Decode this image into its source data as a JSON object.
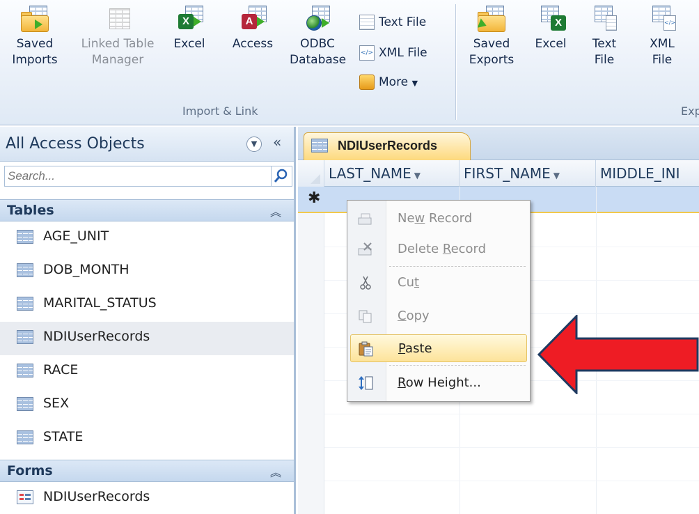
{
  "ribbon": {
    "import_group": {
      "label": "Import & Link",
      "saved_imports": "Saved Imports",
      "linked_table_manager": "Linked Table Manager",
      "excel": "Excel",
      "access": "Access",
      "odbc_database": "ODBC Database",
      "text_file": "Text File",
      "xml_file": "XML File",
      "more": "More"
    },
    "export_group": {
      "label_partial": "Exp",
      "saved_exports": "Saved Exports",
      "excel": "Excel",
      "text_file": "Text File",
      "xml_file": "XML File"
    }
  },
  "nav": {
    "title": "All Access Objects",
    "search_placeholder": "Search...",
    "tables_header": "Tables",
    "tables": [
      {
        "label": "AGE_UNIT"
      },
      {
        "label": "DOB_MONTH"
      },
      {
        "label": "MARITAL_STATUS"
      },
      {
        "label": "NDIUserRecords"
      },
      {
        "label": "RACE"
      },
      {
        "label": "SEX"
      },
      {
        "label": "STATE"
      }
    ],
    "forms_header": "Forms",
    "forms": [
      {
        "label": "NDIUserRecords"
      }
    ]
  },
  "document": {
    "tab_label": "NDIUserRecords",
    "columns": [
      "LAST_NAME",
      "FIRST_NAME",
      "MIDDLE_INI"
    ],
    "new_row_marker": "✱"
  },
  "context_menu": {
    "items": [
      {
        "pre": "Ne",
        "ul": "w",
        "post": " Record"
      },
      {
        "pre": "Delete ",
        "ul": "R",
        "post": "ecord"
      },
      {
        "pre": "Cu",
        "ul": "t",
        "post": ""
      },
      {
        "pre": "",
        "ul": "C",
        "post": "opy"
      },
      {
        "pre": "",
        "ul": "P",
        "post": "aste"
      },
      {
        "pre": "",
        "ul": "R",
        "post": "ow Height..."
      }
    ]
  },
  "colors": {
    "callout_arrow": "#ee1c24",
    "highlight": "#fde39a",
    "selection_row": "#c9dcf4"
  }
}
